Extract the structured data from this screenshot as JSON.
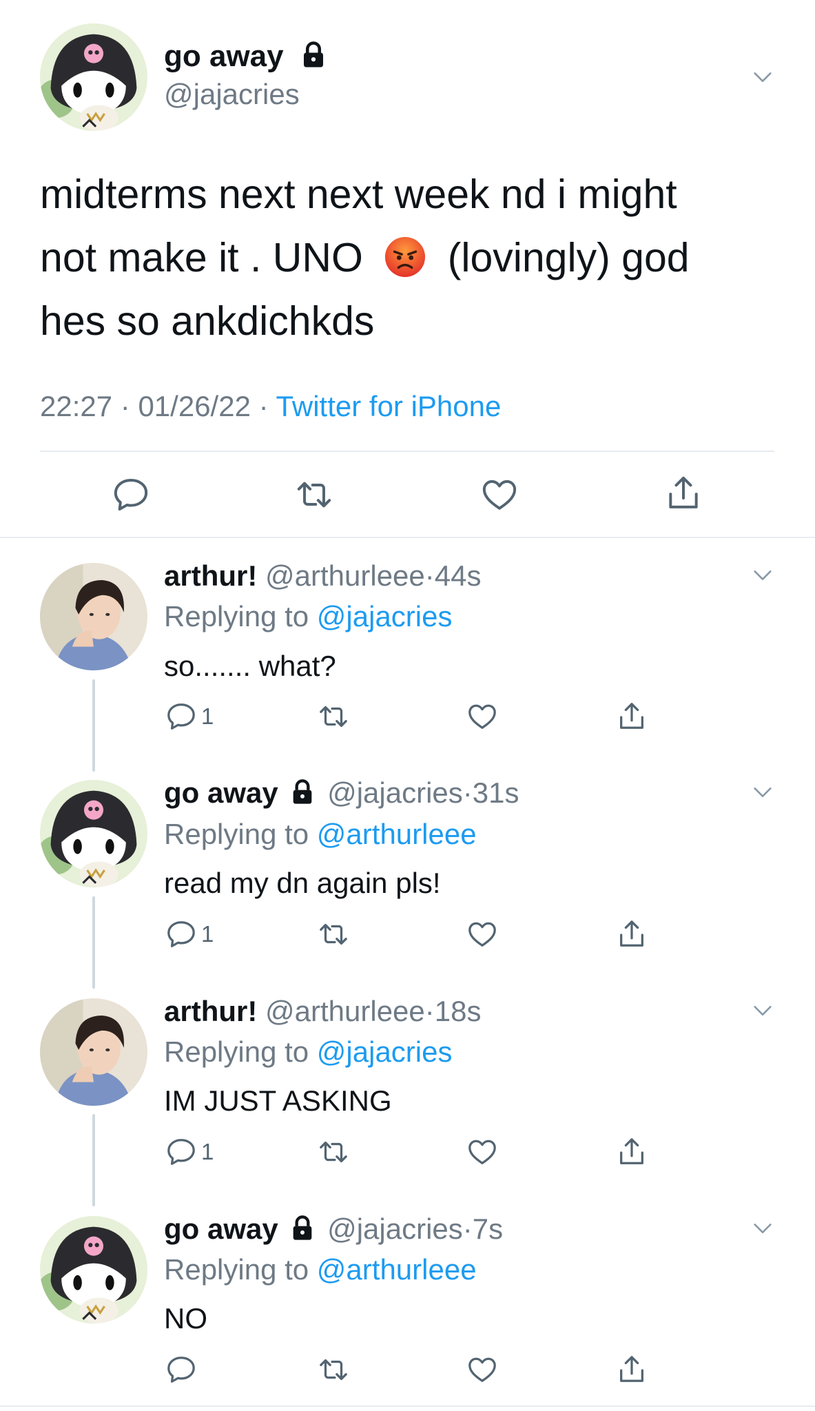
{
  "main": {
    "display_name": "go away",
    "handle": "@jajacries",
    "text_line1": "midterms next next week nd i might",
    "text_line2_a": "not make it . UNO",
    "emoji": "angry-face-emoji",
    "text_line2_b": "(lovingly) god",
    "text_line3": "hes so ankdichkds",
    "time": "22:27",
    "date": "01/26/22",
    "source": "Twitter for iPhone"
  },
  "replies": [
    {
      "name": "arthur!",
      "handle": "@arthurleee",
      "time": "44s",
      "replying_label": "Replying to",
      "replying_to": "@jajacries",
      "text": "so....... what?",
      "reply_count": "1"
    },
    {
      "name": "go away",
      "handle": "@jajacries",
      "time": "31s",
      "replying_label": "Replying to",
      "replying_to": "@arthurleee",
      "text": "read my dn again pls!",
      "reply_count": "1"
    },
    {
      "name": "arthur!",
      "handle": "@arthurleee",
      "time": "18s",
      "replying_label": "Replying to",
      "replying_to": "@jajacries",
      "text": "IM JUST ASKING",
      "reply_count": "1"
    },
    {
      "name": "go away",
      "handle": "@jajacries",
      "time": "7s",
      "replying_label": "Replying to",
      "replying_to": "@arthurleee",
      "text": "NO",
      "reply_count": ""
    }
  ],
  "separator": "·",
  "colors": {
    "link": "#1d9bf0",
    "muted": "#6e7a85",
    "icon": "#536471",
    "line": "#cfd9de"
  },
  "icons": [
    "lock-icon",
    "chevron-down-icon",
    "reply-icon",
    "retweet-icon",
    "like-icon",
    "share-icon"
  ]
}
